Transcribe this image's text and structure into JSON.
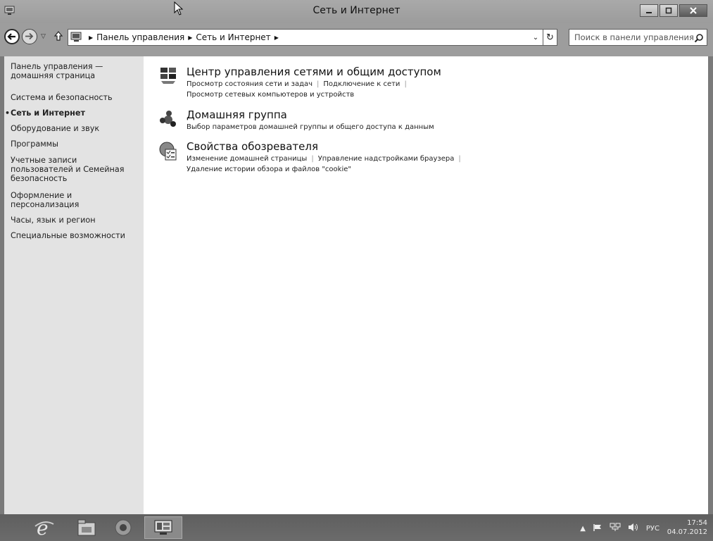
{
  "window": {
    "title": "Сеть и Интернет"
  },
  "address_bar": {
    "crumbs": [
      "Панель управления",
      "Сеть и Интернет"
    ],
    "search_placeholder": "Поиск в панели управления"
  },
  "sidebar": {
    "items": [
      {
        "label": "Панель управления — домашняя страница",
        "current": false
      },
      {
        "label": "Система и безопасность",
        "current": false
      },
      {
        "label": "Сеть и Интернет",
        "current": true
      },
      {
        "label": "Оборудование и звук",
        "current": false
      },
      {
        "label": "Программы",
        "current": false
      },
      {
        "label": "Учетные записи пользователей и Семейная безопасность",
        "current": false
      },
      {
        "label": "Оформление и персонализация",
        "current": false
      },
      {
        "label": "Часы, язык и регион",
        "current": false
      },
      {
        "label": "Специальные возможности",
        "current": false
      }
    ]
  },
  "categories": [
    {
      "title": "Центр управления сетями и общим доступом",
      "icon": "network-center-icon",
      "links": [
        "Просмотр состояния сети и задач",
        "Подключение к сети",
        "Просмотр сетевых компьютеров и устройств"
      ]
    },
    {
      "title": "Домашняя группа",
      "icon": "homegroup-icon",
      "links": [
        "Выбор параметров домашней группы и общего доступа к данным"
      ]
    },
    {
      "title": "Свойства обозревателя",
      "icon": "internet-options-icon",
      "links": [
        "Изменение домашней страницы",
        "Управление надстройками браузера",
        "Удаление истории обзора и файлов \"cookie\""
      ]
    }
  ],
  "taskbar": {
    "apps": [
      "internet-explorer-icon",
      "file-explorer-icon",
      "media-icon",
      "control-panel-icon"
    ],
    "language": "РУС",
    "time": "17:54",
    "date": "04.07.2012"
  }
}
